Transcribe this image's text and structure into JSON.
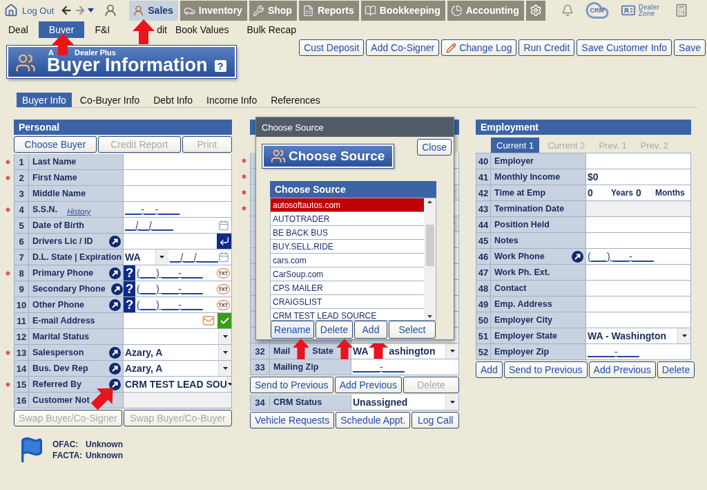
{
  "top_nav": {
    "logout": "Log Out",
    "modules": [
      {
        "label": "Sales",
        "selected": true
      },
      {
        "label": "Inventory",
        "selected": false
      },
      {
        "label": "Shop",
        "selected": false
      },
      {
        "label": "Reports",
        "selected": false
      },
      {
        "label": "Bookkeeping",
        "selected": false
      },
      {
        "label": "Accounting",
        "selected": false
      }
    ],
    "crm": "CRM",
    "dealer_zone": "Dealer Zone"
  },
  "sub_nav": [
    {
      "label": "Deal",
      "selected": false
    },
    {
      "label": "Buyer",
      "selected": true
    },
    {
      "label": "F&I",
      "selected": false
    },
    {
      "label": "dit",
      "selected": false
    },
    {
      "label": "Book Values",
      "selected": false
    },
    {
      "label": "Bulk Recap",
      "selected": false
    }
  ],
  "banner": {
    "subtitle": [
      "A",
      "Dealer Plus"
    ],
    "title": "Buyer Information",
    "help": "?"
  },
  "actions": [
    "Cust Deposit",
    "Add Co-Signer",
    "Change Log",
    "Run Credit",
    "Save Customer Info",
    "Save"
  ],
  "tabs": [
    {
      "label": "Buyer Info",
      "selected": true
    },
    {
      "label": "Co-Buyer Info",
      "selected": false
    },
    {
      "label": "Debt Info",
      "selected": false
    },
    {
      "label": "Income Info",
      "selected": false
    },
    {
      "label": "References",
      "selected": false
    }
  ],
  "personal": {
    "title": "Personal",
    "buttons": [
      {
        "label": "Choose Buyer",
        "disabled": false
      },
      {
        "label": "Credit Report",
        "disabled": true
      },
      {
        "label": "Print",
        "disabled": true
      }
    ],
    "items": [
      {
        "kind": "text",
        "num": "1",
        "label": "Last Name",
        "required": true,
        "shortcut": false
      },
      {
        "kind": "text",
        "num": "2",
        "label": "First Name",
        "required": true,
        "shortcut": false
      },
      {
        "kind": "text",
        "num": "3",
        "label": "Middle Name",
        "required": false,
        "shortcut": false
      },
      {
        "kind": "mask",
        "num": "4",
        "label": "S.S.N.",
        "link": "History",
        "value": "___-__-____",
        "required": true,
        "shortcut": false
      },
      {
        "kind": "date",
        "num": "5",
        "label": "Date of Birth",
        "value": "__/__/____",
        "required": false,
        "shortcut": false
      },
      {
        "kind": "license",
        "num": "6",
        "label": "Drivers Lic / ID",
        "required": false,
        "shortcut": true
      },
      {
        "kind": "state_date",
        "num": "7",
        "label": "D.L. State | Expiration",
        "value": "WA",
        "mask": "__/__/____",
        "required": false,
        "shortcut": false
      },
      {
        "kind": "phone",
        "num": "8",
        "label": "Primary Phone",
        "help": "?",
        "value": "(___) ___-____",
        "sms": "TXT",
        "required": true,
        "shortcut": true
      },
      {
        "kind": "phone",
        "num": "9",
        "label": "Secondary Phone",
        "help": "?",
        "value": "(___) ___-____",
        "sms": "TXT",
        "required": false,
        "shortcut": true
      },
      {
        "kind": "phone",
        "num": "10",
        "label": "Other Phone",
        "help": "?",
        "value": "(___) ___-____",
        "sms": "TXT",
        "required": false,
        "shortcut": true
      },
      {
        "kind": "email",
        "num": "11",
        "label": "E-mail Address",
        "required": false,
        "shortcut": false
      },
      {
        "kind": "select",
        "num": "12",
        "label": "Marital Status",
        "required": false,
        "shortcut": false
      },
      {
        "kind": "select",
        "num": "13",
        "label": "Salesperson",
        "value": "Azary, A",
        "required": true,
        "shortcut": true
      },
      {
        "kind": "select",
        "num": "14",
        "label": "Bus. Dev Rep",
        "value": "Azary, A",
        "required": false,
        "shortcut": true
      },
      {
        "kind": "select",
        "num": "15",
        "label": "Referred By",
        "value": "CRM TEST LEAD SOU",
        "required": true,
        "shortcut": true
      },
      {
        "kind": "readonly",
        "num": "16",
        "label": "Customer Not",
        "required": false,
        "shortcut": false
      },
      {
        "kind": "buttons",
        "buttons": [
          {
            "label": "Swap Buyer/Co-Signer",
            "disabled": true
          },
          {
            "label": "Swap Buyer/Co-Buyer",
            "disabled": true
          }
        ]
      }
    ],
    "checks": [
      {
        "label": "OFAC:",
        "value": "Unknown"
      },
      {
        "label": "FACTA:",
        "value": "Unknown"
      }
    ]
  },
  "address": {
    "items": [
      {
        "kind": "text",
        "required": true,
        "shortcut": false
      },
      {
        "kind": "text",
        "required": true,
        "shortcut": false
      },
      {
        "kind": "select",
        "required": true,
        "shortcut": false
      },
      {
        "kind": "text",
        "required": true,
        "shortcut": false
      },
      {
        "kind": "select",
        "required": false,
        "shortcut": false
      },
      {
        "kind": "text",
        "required": false,
        "shortcut": false
      },
      {
        "kind": "text",
        "required": false,
        "shortcut": false
      },
      {
        "kind": "text",
        "required": false,
        "shortcut": false
      },
      {
        "kind": "text",
        "required": false,
        "shortcut": false
      },
      {
        "kind": "text",
        "required": false,
        "shortcut": false
      },
      {
        "kind": "text",
        "required": false,
        "shortcut": false
      },
      {
        "kind": "text",
        "required": false,
        "shortcut": false
      },
      {
        "kind": "split",
        "num": "32",
        "label_parts": [
          "Mail",
          "State"
        ],
        "value_parts": [
          "WA",
          "ashington"
        ],
        "required": false,
        "shortcut": false
      },
      {
        "kind": "mask",
        "num": "33",
        "label": "Mailing Zip",
        "value": "_____-____",
        "required": false,
        "shortcut": false
      },
      {
        "kind": "buttons",
        "buttons": [
          {
            "label": "Send to Previous",
            "disabled": false
          },
          {
            "label": "Add Previous",
            "disabled": false
          },
          {
            "label": "Delete",
            "disabled": true
          }
        ]
      },
      {
        "kind": "select",
        "num": "34",
        "label": "CRM Status",
        "value": "Unassigned",
        "required": false,
        "shortcut": false
      },
      {
        "kind": "buttons",
        "buttons": [
          {
            "label": "Vehicle Requests",
            "disabled": false
          },
          {
            "label": "Schedule Appt.",
            "disabled": false
          },
          {
            "label": "Log Call",
            "disabled": false
          }
        ]
      }
    ]
  },
  "employment": {
    "title": "Employment",
    "tabs": [
      {
        "label": "Current 1",
        "selected": true
      },
      {
        "label": "Current 2",
        "selected": false
      },
      {
        "label": "Prev. 1",
        "selected": false
      },
      {
        "label": "Prev. 2",
        "selected": false
      }
    ],
    "items": [
      {
        "kind": "text",
        "num": "40",
        "label": "Employer",
        "required": false,
        "shortcut": false
      },
      {
        "kind": "text",
        "num": "41",
        "label": "Monthly Income",
        "value": "$0",
        "required": false,
        "shortcut": false
      },
      {
        "kind": "duration",
        "num": "42",
        "label": "Time at Emp",
        "parts": [
          "0",
          "Years",
          "0",
          "Months"
        ],
        "required": false,
        "shortcut": false
      },
      {
        "kind": "readonly",
        "num": "43",
        "label": "Termination Date",
        "required": false,
        "shortcut": false
      },
      {
        "kind": "text",
        "num": "44",
        "label": "Position Held",
        "required": false,
        "shortcut": false
      },
      {
        "kind": "text",
        "num": "45",
        "label": "Notes",
        "required": false,
        "shortcut": false
      },
      {
        "kind": "mask",
        "num": "46",
        "label": "Work Phone",
        "value": "(___) ___-____",
        "required": false,
        "shortcut": true
      },
      {
        "kind": "text",
        "num": "47",
        "label": "Work Ph. Ext.",
        "required": false,
        "shortcut": false
      },
      {
        "kind": "text",
        "num": "48",
        "label": "Contact",
        "required": false,
        "shortcut": false
      },
      {
        "kind": "text",
        "num": "49",
        "label": "Emp. Address",
        "required": false,
        "shortcut": false
      },
      {
        "kind": "text",
        "num": "50",
        "label": "Employer City",
        "required": false,
        "shortcut": false
      },
      {
        "kind": "select",
        "num": "51",
        "label": "Employer State",
        "value": "WA - Washington",
        "required": false,
        "shortcut": false
      },
      {
        "kind": "mask",
        "num": "52",
        "label": "Employer Zip",
        "value": "_____-____",
        "required": false,
        "shortcut": false
      },
      {
        "kind": "buttons",
        "buttons": [
          {
            "label": "Add",
            "disabled": false
          },
          {
            "label": "Send to Previous",
            "disabled": false
          },
          {
            "label": "Add Previous",
            "disabled": false
          },
          {
            "label": "Delete",
            "disabled": false
          }
        ]
      }
    ]
  },
  "dialog": {
    "title": "Choose Source",
    "close": "Close",
    "banner": "Choose Source",
    "list_title": "Choose Source",
    "items": [
      {
        "label": "autosoftautos.com",
        "selected": true
      },
      {
        "label": "AUTOTRADER",
        "selected": false
      },
      {
        "label": "BE BACK BUS",
        "selected": false
      },
      {
        "label": "BUY.SELL.RIDE",
        "selected": false
      },
      {
        "label": "cars.com",
        "selected": false
      },
      {
        "label": "CarSoup.com",
        "selected": false
      },
      {
        "label": "CPS MAILER",
        "selected": false
      },
      {
        "label": "CRAIGSLIST",
        "selected": false
      },
      {
        "label": "CRM TEST LEAD SOURCE",
        "selected": false
      }
    ],
    "buttons": [
      {
        "label": "Rename",
        "focused": true
      },
      {
        "label": "Delete",
        "focused": false
      },
      {
        "label": "Add",
        "focused": false
      },
      {
        "label": "Select",
        "focused": false
      }
    ]
  }
}
